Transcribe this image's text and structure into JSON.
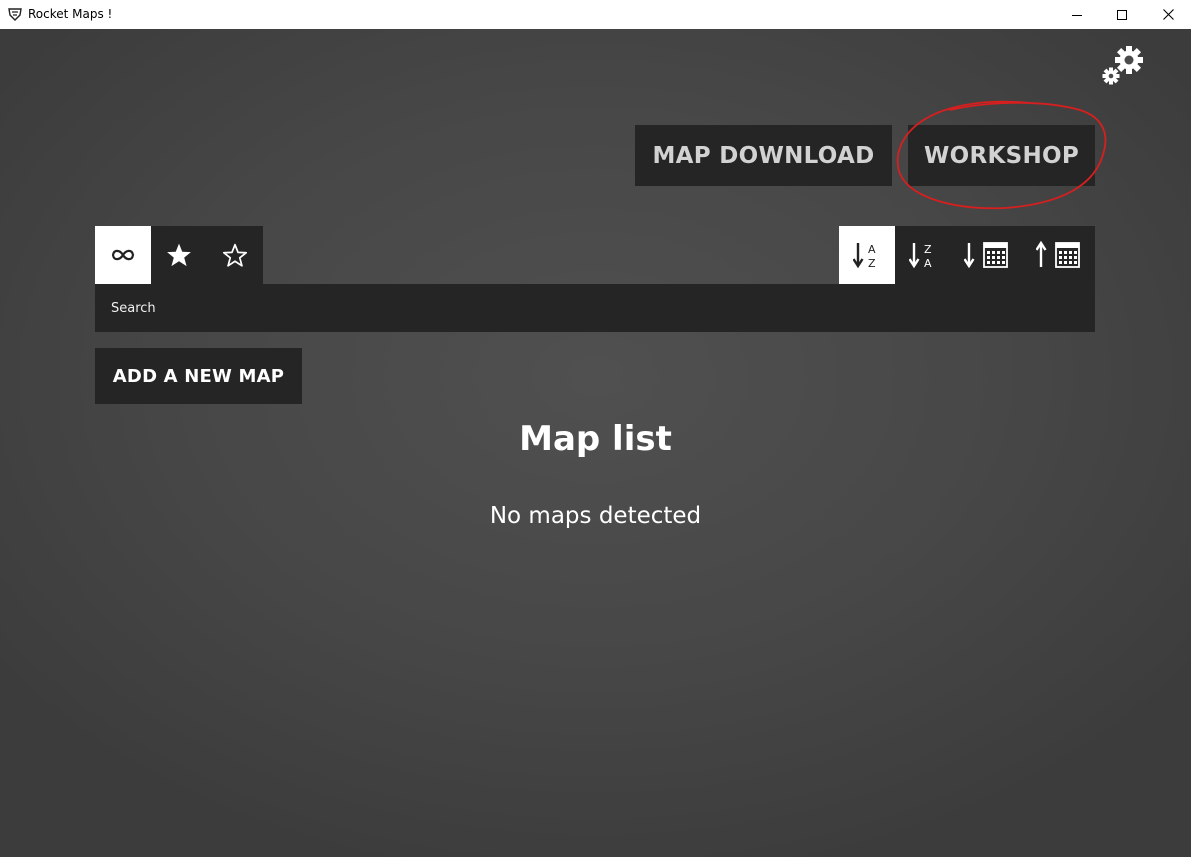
{
  "window": {
    "title": "Rocket Maps !"
  },
  "header": {
    "settings_icon": "gears-icon",
    "map_download_label": "MAP DOWNLOAD",
    "workshop_label": "WORKSHOP",
    "annotation_color": "#d61f1f"
  },
  "filters": {
    "tabs": [
      {
        "icon": "infinity-icon",
        "active": true
      },
      {
        "icon": "star-filled-icon",
        "active": false
      },
      {
        "icon": "star-outline-icon",
        "active": false
      }
    ]
  },
  "sort": {
    "options": [
      {
        "icon": "sort-alpha-asc-icon",
        "letters": [
          "A",
          "Z"
        ],
        "active": true
      },
      {
        "icon": "sort-alpha-desc-icon",
        "letters": [
          "Z",
          "A"
        ],
        "active": false
      },
      {
        "icon": "sort-date-desc-icon",
        "active": false
      },
      {
        "icon": "sort-date-asc-icon",
        "active": false
      }
    ]
  },
  "search": {
    "placeholder": "Search"
  },
  "actions": {
    "add_map_label": "ADD A NEW MAP"
  },
  "map_list": {
    "title": "Map list",
    "empty_message": "No maps detected"
  },
  "colors": {
    "background": "#474747",
    "panel": "#252525",
    "active_tab": "#ffffff",
    "button_text": "#d2d2d2"
  }
}
